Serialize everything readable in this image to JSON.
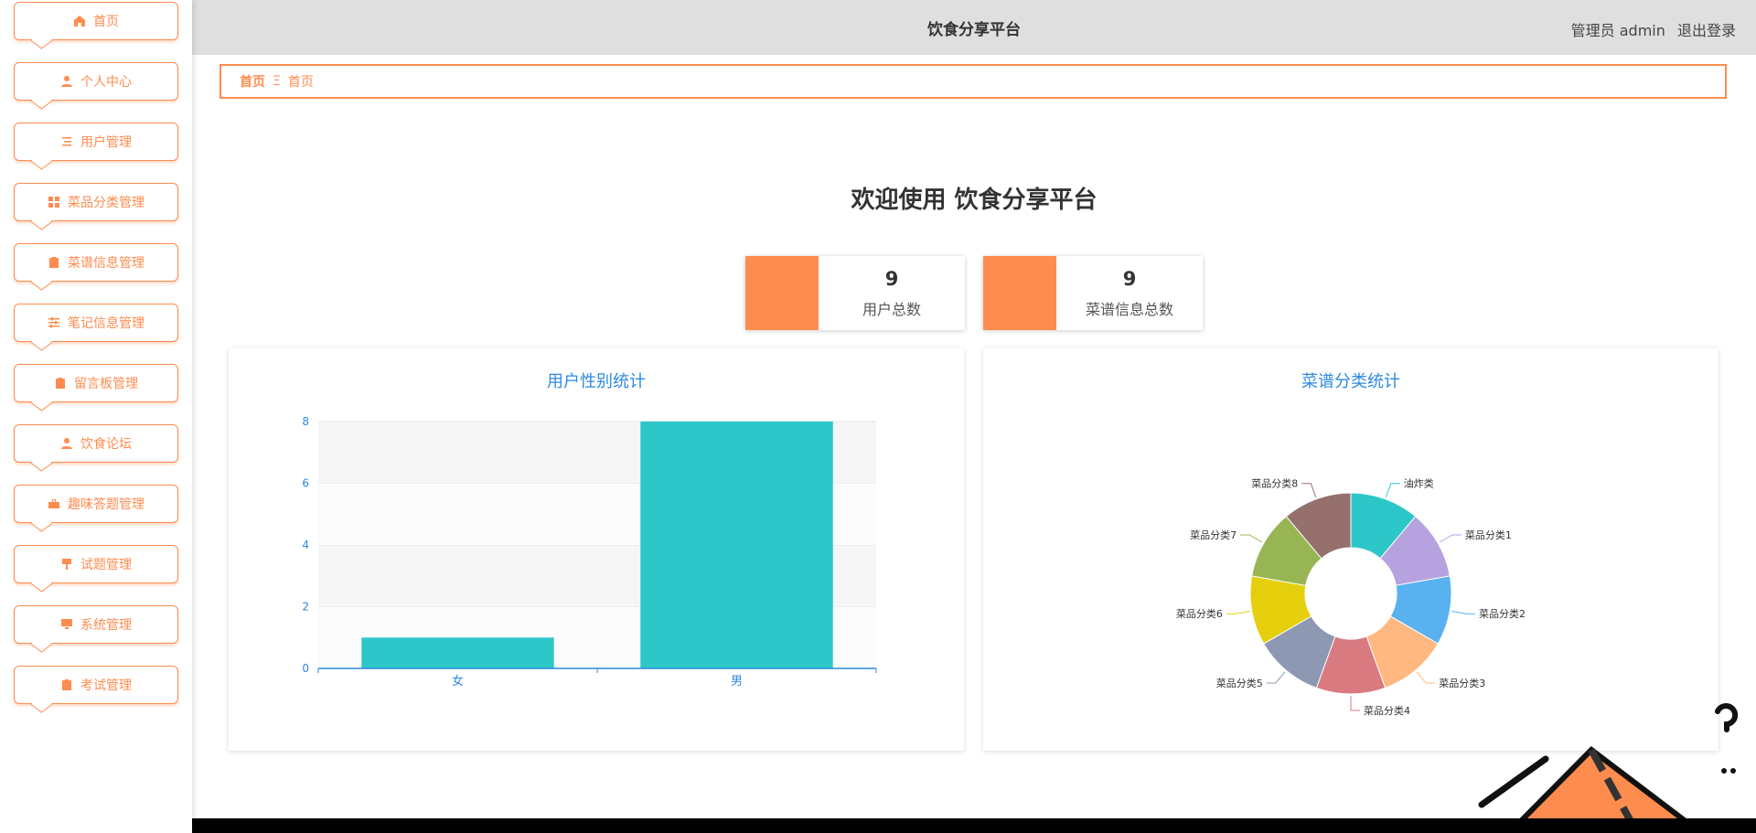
{
  "header": {
    "title": "饮食分享平台",
    "user_role": "管理员 admin",
    "logout": "退出登录"
  },
  "sidebar": {
    "items": [
      {
        "label": "首页",
        "icon": "home-icon"
      },
      {
        "label": "个人中心",
        "icon": "user-icon"
      },
      {
        "label": "用户管理",
        "icon": "list-icon"
      },
      {
        "label": "菜品分类管理",
        "icon": "grid-icon"
      },
      {
        "label": "菜谱信息管理",
        "icon": "clipboard-check-icon"
      },
      {
        "label": "笔记信息管理",
        "icon": "sliders-icon"
      },
      {
        "label": "留言板管理",
        "icon": "clipboard-icon"
      },
      {
        "label": "饮食论坛",
        "icon": "user-icon"
      },
      {
        "label": "趣味答题管理",
        "icon": "briefcase-icon"
      },
      {
        "label": "试题管理",
        "icon": "brush-icon"
      },
      {
        "label": "系统管理",
        "icon": "monitor-icon"
      },
      {
        "label": "考试管理",
        "icon": "clipboard-x-icon"
      }
    ]
  },
  "breadcrumb": {
    "home": "首页",
    "separator": "Ξ",
    "current": "首页"
  },
  "welcome": "欢迎使用 饮食分享平台",
  "stats": [
    {
      "value": "9",
      "label": "用户总数"
    },
    {
      "value": "9",
      "label": "菜谱信息总数"
    }
  ],
  "colors": {
    "accent": "#ff8c4f",
    "chart_title": "#2c8ae0",
    "bar": "#2ec7c9"
  },
  "chart_data": [
    {
      "type": "bar",
      "title": "用户性别统计",
      "categories": [
        "女",
        "男"
      ],
      "values": [
        1,
        8
      ],
      "ylim": [
        0,
        8
      ],
      "yticks": [
        0,
        2,
        4,
        6,
        8
      ],
      "grid": true
    },
    {
      "type": "pie",
      "title": "菜谱分类统计",
      "donut": true,
      "categories": [
        "油炸类",
        "菜品分类1",
        "菜品分类2",
        "菜品分类3",
        "菜品分类4",
        "菜品分类5",
        "菜品分类6",
        "菜品分类7",
        "菜品分类8"
      ],
      "values": [
        1,
        1,
        1,
        1,
        1,
        1,
        1,
        1,
        1
      ],
      "colors": [
        "#2ec7c9",
        "#b6a2de",
        "#5ab1ef",
        "#ffb980",
        "#d87a80",
        "#8d98b3",
        "#e5cf0d",
        "#97b552",
        "#95706d"
      ]
    }
  ]
}
